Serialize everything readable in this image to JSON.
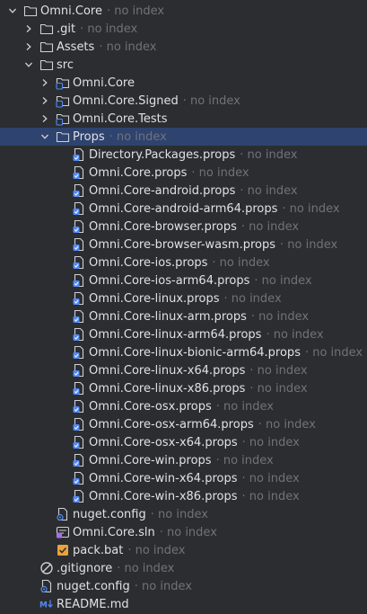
{
  "hint": "· no index",
  "tree": [
    {
      "label": "Omni.Core",
      "depth": 0,
      "kind": "folder",
      "state": "open",
      "hint": true
    },
    {
      "label": ".git",
      "depth": 1,
      "kind": "folder",
      "state": "closed",
      "hint": true
    },
    {
      "label": "Assets",
      "depth": 1,
      "kind": "folder",
      "state": "closed",
      "hint": true
    },
    {
      "label": "src",
      "depth": 1,
      "kind": "folder",
      "state": "open",
      "hint": false
    },
    {
      "label": "Omni.Core",
      "depth": 2,
      "kind": "project",
      "state": "closed",
      "hint": false
    },
    {
      "label": "Omni.Core.Signed",
      "depth": 2,
      "kind": "project",
      "state": "closed",
      "hint": true
    },
    {
      "label": "Omni.Core.Tests",
      "depth": 2,
      "kind": "project",
      "state": "closed",
      "hint": false
    },
    {
      "label": "Props",
      "depth": 2,
      "kind": "folder",
      "state": "open",
      "hint": true,
      "selected": true
    },
    {
      "label": "Directory.Packages.props",
      "depth": 3,
      "kind": "props",
      "state": "leaf",
      "hint": true
    },
    {
      "label": "Omni.Core.props",
      "depth": 3,
      "kind": "props",
      "state": "leaf",
      "hint": true
    },
    {
      "label": "Omni.Core-android.props",
      "depth": 3,
      "kind": "props",
      "state": "leaf",
      "hint": true
    },
    {
      "label": "Omni.Core-android-arm64.props",
      "depth": 3,
      "kind": "props",
      "state": "leaf",
      "hint": true
    },
    {
      "label": "Omni.Core-browser.props",
      "depth": 3,
      "kind": "props",
      "state": "leaf",
      "hint": true
    },
    {
      "label": "Omni.Core-browser-wasm.props",
      "depth": 3,
      "kind": "props",
      "state": "leaf",
      "hint": true
    },
    {
      "label": "Omni.Core-ios.props",
      "depth": 3,
      "kind": "props",
      "state": "leaf",
      "hint": true
    },
    {
      "label": "Omni.Core-ios-arm64.props",
      "depth": 3,
      "kind": "props",
      "state": "leaf",
      "hint": true
    },
    {
      "label": "Omni.Core-linux.props",
      "depth": 3,
      "kind": "props",
      "state": "leaf",
      "hint": true
    },
    {
      "label": "Omni.Core-linux-arm.props",
      "depth": 3,
      "kind": "props",
      "state": "leaf",
      "hint": true
    },
    {
      "label": "Omni.Core-linux-arm64.props",
      "depth": 3,
      "kind": "props",
      "state": "leaf",
      "hint": true
    },
    {
      "label": "Omni.Core-linux-bionic-arm64.props",
      "depth": 3,
      "kind": "props",
      "state": "leaf",
      "hint": true
    },
    {
      "label": "Omni.Core-linux-x64.props",
      "depth": 3,
      "kind": "props",
      "state": "leaf",
      "hint": true
    },
    {
      "label": "Omni.Core-linux-x86.props",
      "depth": 3,
      "kind": "props",
      "state": "leaf",
      "hint": true
    },
    {
      "label": "Omni.Core-osx.props",
      "depth": 3,
      "kind": "props",
      "state": "leaf",
      "hint": true
    },
    {
      "label": "Omni.Core-osx-arm64.props",
      "depth": 3,
      "kind": "props",
      "state": "leaf",
      "hint": true
    },
    {
      "label": "Omni.Core-osx-x64.props",
      "depth": 3,
      "kind": "props",
      "state": "leaf",
      "hint": true
    },
    {
      "label": "Omni.Core-win.props",
      "depth": 3,
      "kind": "props",
      "state": "leaf",
      "hint": true
    },
    {
      "label": "Omni.Core-win-x64.props",
      "depth": 3,
      "kind": "props",
      "state": "leaf",
      "hint": true
    },
    {
      "label": "Omni.Core-win-x86.props",
      "depth": 3,
      "kind": "props",
      "state": "leaf",
      "hint": true
    },
    {
      "label": "nuget.config",
      "depth": 2,
      "kind": "config",
      "state": "leaf",
      "hint": true
    },
    {
      "label": "Omni.Core.sln",
      "depth": 2,
      "kind": "sln",
      "state": "leaf",
      "hint": true
    },
    {
      "label": "pack.bat",
      "depth": 2,
      "kind": "bat",
      "state": "leaf",
      "hint": true
    },
    {
      "label": ".gitignore",
      "depth": 1,
      "kind": "ignore",
      "state": "leaf",
      "hint": true
    },
    {
      "label": "nuget.config",
      "depth": 1,
      "kind": "config",
      "state": "leaf",
      "hint": true
    },
    {
      "label": "README.md",
      "depth": 1,
      "kind": "md",
      "state": "leaf",
      "hint": false
    }
  ],
  "icons": {
    "folder": "folder-icon",
    "project": "project-folder-icon",
    "props": "props-file-icon",
    "config": "config-file-icon",
    "sln": "solution-file-icon",
    "bat": "batch-file-icon",
    "ignore": "gitignore-icon",
    "md": "markdown-icon"
  },
  "colors": {
    "background": "#2b2d30",
    "selection": "#2e436e",
    "text": "#dfe1e5",
    "hint": "#6f737a",
    "project_accent": "#548af7"
  }
}
